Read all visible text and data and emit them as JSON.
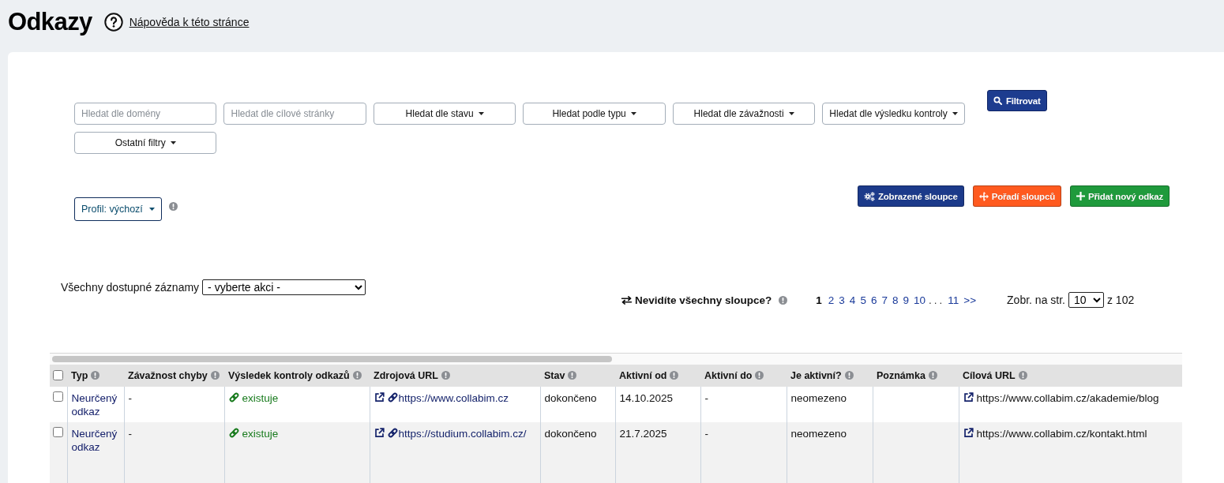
{
  "header": {
    "title": "Odkazy",
    "help_link": "Nápověda k této stránce"
  },
  "filters": [
    {
      "kind": "input",
      "placeholder": "Hledat dle domény"
    },
    {
      "kind": "input",
      "placeholder": "Hledat dle cílové stránky"
    },
    {
      "kind": "dropdown",
      "label": "Hledat dle stavu"
    },
    {
      "kind": "dropdown",
      "label": "Hledat podle typu"
    },
    {
      "kind": "dropdown",
      "label": "Hledat dle závažnosti"
    },
    {
      "kind": "dropdown",
      "label": "Hledat dle výsledku kontroly"
    },
    {
      "kind": "dropdown",
      "label": "Ostatní filtry"
    }
  ],
  "filter_button": {
    "label": "Filtrovat"
  },
  "profile": {
    "label": "Profil: výchozí"
  },
  "actions": [
    {
      "kind": "columns",
      "label": "Zobrazené sloupce",
      "color": "#1c3a8a"
    },
    {
      "kind": "order",
      "label": "Pořadí sloupců",
      "color": "#ff5a1f"
    },
    {
      "kind": "add",
      "label": "Přidat nový odkaz",
      "color": "#1f9a3c"
    }
  ],
  "bulk_actions": {
    "label": "Všechny dostupné záznamy",
    "value": "- vyberte akci -"
  },
  "columns_hint": {
    "label": "Nevidíte všechny sloupce?"
  },
  "pagination": {
    "items": [
      {
        "kind": "page",
        "label": "1",
        "selected": true
      },
      {
        "kind": "page",
        "label": "2",
        "selected": false
      },
      {
        "kind": "page",
        "label": "3",
        "selected": false
      },
      {
        "kind": "page",
        "label": "4",
        "selected": false
      },
      {
        "kind": "page",
        "label": "5",
        "selected": false
      },
      {
        "kind": "page",
        "label": "6",
        "selected": false
      },
      {
        "kind": "page",
        "label": "7",
        "selected": false
      },
      {
        "kind": "page",
        "label": "8",
        "selected": false
      },
      {
        "kind": "page",
        "label": "9",
        "selected": false
      },
      {
        "kind": "page",
        "label": "10",
        "selected": false
      },
      {
        "kind": "gap",
        "label": "..."
      },
      {
        "kind": "page",
        "label": "11",
        "selected": false
      },
      {
        "kind": "next",
        "label": ">>"
      }
    ]
  },
  "per_page": {
    "label": "Zobr. na str.",
    "value": "10",
    "total": "z 102"
  },
  "table": {
    "select_all": {
      "checked": false
    },
    "columns": [
      {
        "label": "Typ"
      },
      {
        "label": "Závažnost chyby"
      },
      {
        "label": "Výsledek kontroly odkazů"
      },
      {
        "label": "Zdrojová URL"
      },
      {
        "label": "Stav"
      },
      {
        "label": "Aktivní od"
      },
      {
        "label": "Aktivní do"
      },
      {
        "label": "Je aktivní?"
      },
      {
        "label": "Poznámka"
      },
      {
        "label": "Cílová URL"
      }
    ],
    "rows": [
      {
        "checked": false,
        "type": "Neurčený odkaz",
        "severity": "-",
        "check_result": "existuje",
        "source_url": "https://www.collabim.cz",
        "state": "dokončeno",
        "active_from": "14.10.2025",
        "active_to": "-",
        "is_active": "neomezeno",
        "target_url": "https://www.collabim.cz/akademie/blog"
      },
      {
        "checked": false,
        "type": "Neurčený odkaz",
        "severity": "-",
        "check_result": "existuje",
        "source_url": "https://studium.collabim.cz/",
        "state": "dokončeno",
        "active_from": "21.7.2025",
        "active_to": "-",
        "is_active": "neomezeno",
        "target_url": "https://www.collabim.cz/kontakt.html"
      }
    ]
  }
}
